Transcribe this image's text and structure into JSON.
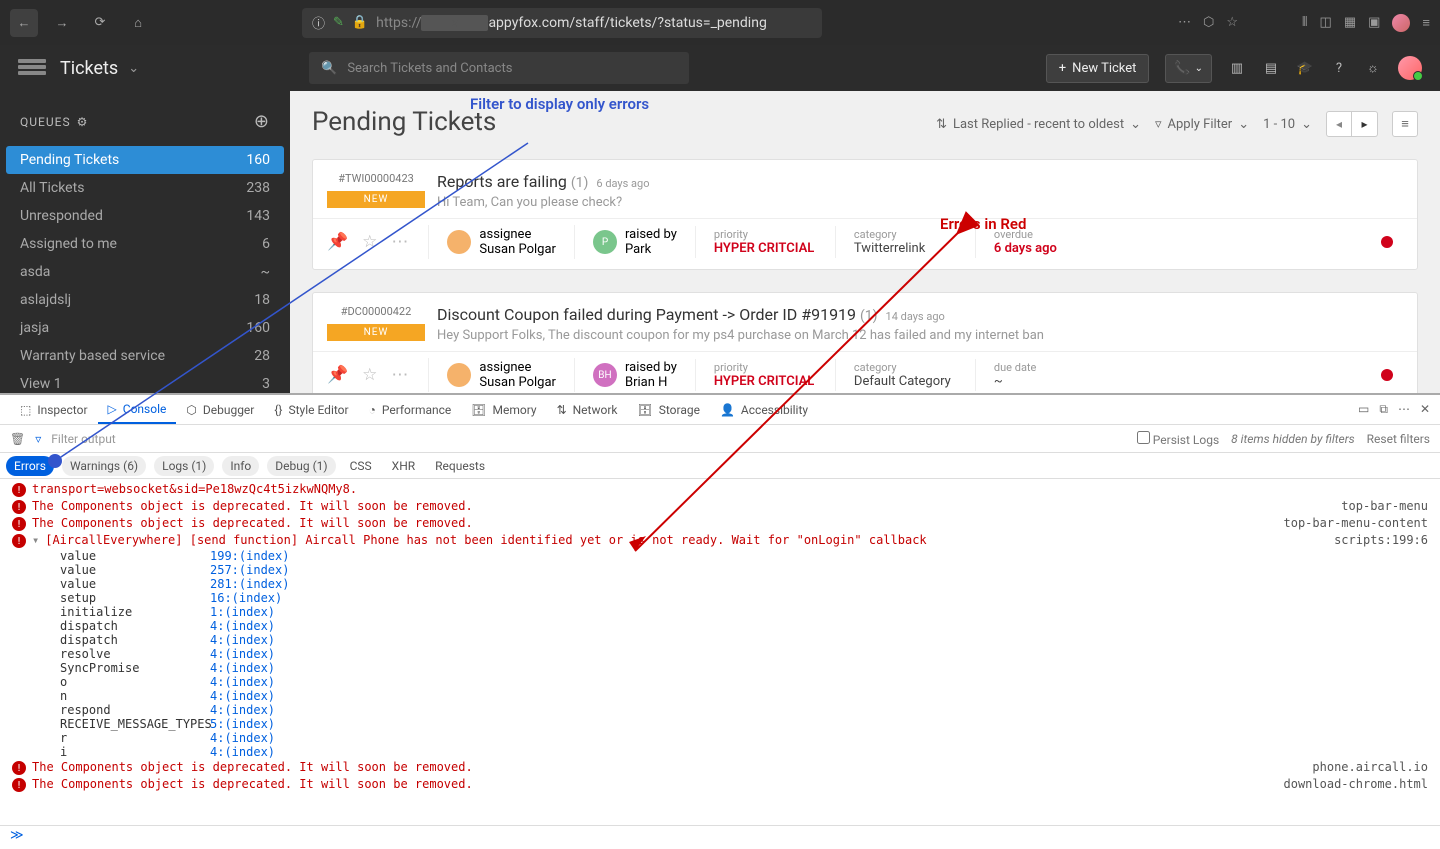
{
  "browser": {
    "url_prefix": "https://",
    "url_mid": "appyfox.com/staff/tickets/?status=_pending"
  },
  "app": {
    "title": "Tickets",
    "search_placeholder": "Search Tickets and Contacts",
    "new_ticket": "New Ticket"
  },
  "sidebar": {
    "header": "QUEUES",
    "items": [
      {
        "label": "Pending Tickets",
        "count": "160",
        "active": true
      },
      {
        "label": "All Tickets",
        "count": "238"
      },
      {
        "label": "Unresponded",
        "count": "143"
      },
      {
        "label": "Assigned to me",
        "count": "6"
      },
      {
        "label": "asda",
        "count": "~"
      },
      {
        "label": "aslajdslj",
        "count": "18"
      },
      {
        "label": "jasja",
        "count": "160"
      },
      {
        "label": "Warranty based service",
        "count": "28"
      },
      {
        "label": "View 1",
        "count": "3"
      }
    ]
  },
  "content": {
    "title": "Pending Tickets",
    "sort_label": "Last Replied - recent to oldest",
    "filter_label": "Apply Filter",
    "pager": "1 - 10"
  },
  "annotations": {
    "filter": "Filter to display only errors",
    "errors_red": "Errors in Red"
  },
  "tickets": [
    {
      "id": "#TWI00000423",
      "status": "NEW",
      "subject": "Reports are failing",
      "count": "(1)",
      "age": "6 days ago",
      "preview": "Hi Team, Can you please check?",
      "assignee": "Susan Polgar",
      "assignee_color": "#f5b26b",
      "raised_by": "Park",
      "raised_initial": "P",
      "raised_color": "#7ac68c",
      "priority": "HYPER CRITCIAL",
      "category": "Twitterrelink",
      "due_label": "overdue",
      "due_value": "6 days ago",
      "due_red": true
    },
    {
      "id": "#DC00000422",
      "status": "NEW",
      "subject": "Discount Coupon failed during Payment -> Order ID #91919",
      "count": "(1)",
      "age": "14 days ago",
      "preview": "Hey Support Folks, The discount coupon for my ps4 purchase on March 12 has failed and my internet ban",
      "assignee": "Susan Polgar",
      "assignee_color": "#f5b26b",
      "raised_by": "Brian H",
      "raised_initial": "BH",
      "raised_color": "#d070c0",
      "priority": "HYPER CRITCIAL",
      "category": "Default Category",
      "due_label": "due date",
      "due_value": "~",
      "due_red": false
    }
  ],
  "devtools": {
    "tabs": [
      "Inspector",
      "Console",
      "Debugger",
      "Style Editor",
      "Performance",
      "Memory",
      "Network",
      "Storage",
      "Accessibility"
    ],
    "active_tab": "Console",
    "filter_placeholder": "Filter output",
    "persist_logs": "Persist Logs",
    "hidden_msg": "8 items hidden by filters",
    "reset": "Reset filters",
    "cats": [
      {
        "label": "Errors",
        "active": true
      },
      {
        "label": "Warnings (6)"
      },
      {
        "label": "Logs (1)"
      },
      {
        "label": "Info"
      },
      {
        "label": "Debug (1)"
      },
      {
        "label": "CSS",
        "plain": true
      },
      {
        "label": "XHR",
        "plain": true
      },
      {
        "label": "Requests",
        "plain": true
      }
    ],
    "logs": {
      "transport_line": "transport=websocket&sid=Pe18wzQc4t5izkwNQMy8.",
      "deprecated": "The Components object is deprecated. It will soon be removed.",
      "src1": "top-bar-menu",
      "src2": "top-bar-menu-content",
      "aircall": "[AircallEverywhere] [send function] Aircall Phone has not been identified yet or is not ready. Wait for \"onLogin\" callback",
      "aircall_src": "scripts:199:6",
      "src_phone": "phone.aircall.io",
      "src_chrome": "download-chrome.html"
    },
    "stack": [
      {
        "fn": "value",
        "loc": "199:(index)"
      },
      {
        "fn": "value",
        "loc": "257:(index)"
      },
      {
        "fn": "value",
        "loc": "281:(index)"
      },
      {
        "fn": "setup",
        "loc": "16:(index)"
      },
      {
        "fn": "initialize",
        "loc": "1:(index)"
      },
      {
        "fn": "dispatch",
        "loc": "4:(index)"
      },
      {
        "fn": "dispatch",
        "loc": "4:(index)"
      },
      {
        "fn": "resolve",
        "loc": "4:(index)"
      },
      {
        "fn": "SyncPromise",
        "loc": "4:(index)"
      },
      {
        "fn": "o",
        "loc": "4:(index)"
      },
      {
        "fn": "n",
        "loc": "4:(index)"
      },
      {
        "fn": "respond",
        "loc": "4:(index)"
      },
      {
        "fn": "RECEIVE_MESSAGE_TYPES",
        "loc": "5:(index)"
      },
      {
        "fn": "r",
        "loc": "4:(index)"
      },
      {
        "fn": "i",
        "loc": "4:(index)"
      }
    ]
  }
}
